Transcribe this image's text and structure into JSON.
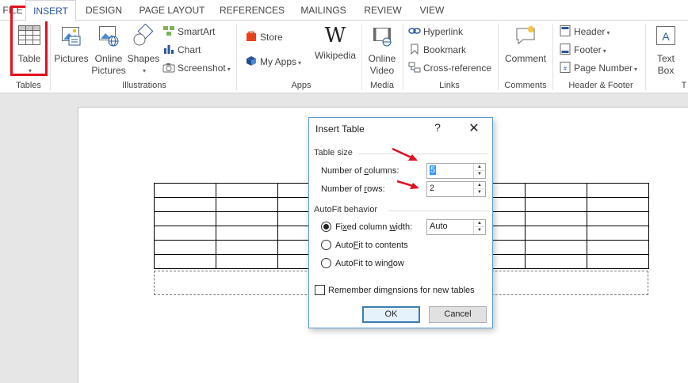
{
  "tabs": [
    {
      "label": "FILE"
    },
    {
      "label": "INSERT"
    },
    {
      "label": "DESIGN"
    },
    {
      "label": "PAGE LAYOUT"
    },
    {
      "label": "REFERENCES"
    },
    {
      "label": "MAILINGS"
    },
    {
      "label": "REVIEW"
    },
    {
      "label": "VIEW"
    }
  ],
  "ribbon": {
    "tables": {
      "table_label": "Table",
      "group_label": "Tables"
    },
    "illustrations": {
      "pictures": "Pictures",
      "online_pictures_1": "Online",
      "online_pictures_2": "Pictures",
      "shapes": "Shapes",
      "smartart": "SmartArt",
      "chart": "Chart",
      "screenshot": "Screenshot",
      "group_label": "Illustrations"
    },
    "apps": {
      "store": "Store",
      "my_apps": "My Apps",
      "wikipedia": "Wikipedia",
      "group_label": "Apps"
    },
    "media": {
      "online_video_1": "Online",
      "online_video_2": "Video",
      "group_label": "Media"
    },
    "links": {
      "hyperlink": "Hyperlink",
      "bookmark": "Bookmark",
      "cross_reference": "Cross-reference",
      "group_label": "Links"
    },
    "comments": {
      "comment": "Comment",
      "group_label": "Comments"
    },
    "header_footer": {
      "header": "Header",
      "footer": "Footer",
      "page_number": "Page Number",
      "group_label": "Header & Footer"
    },
    "text": {
      "text_box_1": "Text",
      "text_box_2": "Box",
      "group_label_partial": "T"
    }
  },
  "dialog": {
    "title": "Insert Table",
    "help": "?",
    "close": "✕",
    "table_size_label": "Table size",
    "num_columns_label": "Number of columns:",
    "num_columns_value": "5",
    "num_rows_label": "Number of rows:",
    "num_rows_value": "2",
    "autofit_label": "AutoFit behavior",
    "fixed_width_label": "Fixed column width:",
    "fixed_width_value": "Auto",
    "autofit_contents_label": "AutoFit to contents",
    "autofit_window_label": "AutoFit to window",
    "remember_label": "Remember dimensions for new tables",
    "ok_label": "OK",
    "cancel_label": "Cancel"
  },
  "colors": {
    "accent": "#2b579a",
    "highlight": "#e0101e",
    "annotation_arrow": "#e0101e"
  }
}
